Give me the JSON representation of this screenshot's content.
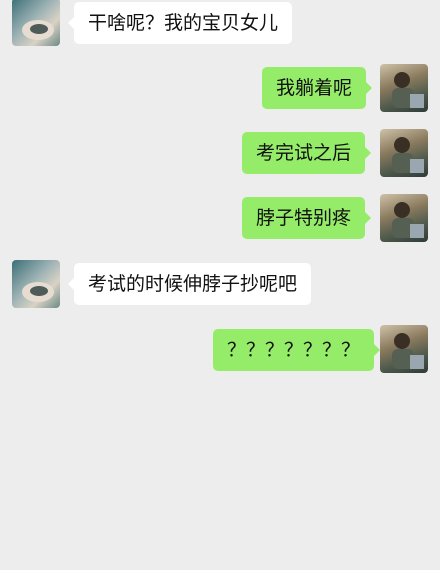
{
  "colors": {
    "background": "#ededed",
    "incoming_bubble": "#ffffff",
    "outgoing_bubble": "#95ec69"
  },
  "messages": [
    {
      "side": "incoming",
      "text": "干啥呢？我的宝贝女儿"
    },
    {
      "side": "outgoing",
      "text": "我躺着呢"
    },
    {
      "side": "outgoing",
      "text": "考完试之后"
    },
    {
      "side": "outgoing",
      "text": "脖子特别疼"
    },
    {
      "side": "incoming",
      "text": "考试的时候伸脖子抄呢吧"
    },
    {
      "side": "outgoing",
      "text": "？？？？？？？"
    }
  ]
}
